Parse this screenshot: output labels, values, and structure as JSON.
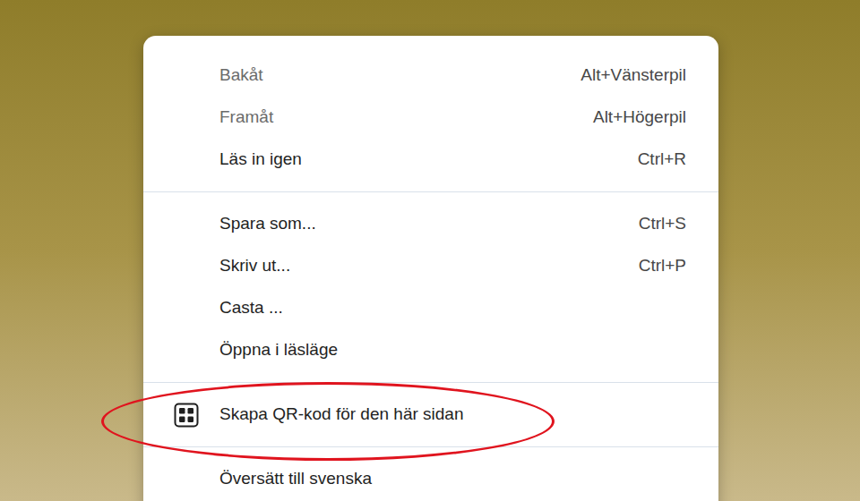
{
  "background": {
    "kind": "photo"
  },
  "context_menu": {
    "sections": [
      {
        "items": [
          {
            "label": "Bakåt",
            "shortcut": "Alt+Vänsterpil",
            "disabled": true,
            "kind": "plain",
            "annotated": false
          },
          {
            "label": "Framåt",
            "shortcut": "Alt+Högerpil",
            "disabled": true,
            "kind": "plain",
            "annotated": false
          },
          {
            "label": "Läs in igen",
            "shortcut": "Ctrl+R",
            "disabled": false,
            "kind": "plain",
            "annotated": false
          }
        ]
      },
      {
        "items": [
          {
            "label": "Spara som...",
            "shortcut": "Ctrl+S",
            "disabled": false,
            "kind": "plain",
            "annotated": false
          },
          {
            "label": "Skriv ut...",
            "shortcut": "Ctrl+P",
            "disabled": false,
            "kind": "plain",
            "annotated": false
          },
          {
            "label": "Casta ...",
            "shortcut": "",
            "disabled": false,
            "kind": "plain",
            "annotated": false
          },
          {
            "label": "Öppna i läsläge",
            "shortcut": "",
            "disabled": false,
            "kind": "plain",
            "annotated": false
          }
        ]
      },
      {
        "items": [
          {
            "label": "Skapa QR-kod för den här sidan",
            "shortcut": "",
            "disabled": false,
            "kind": "icon",
            "annotated": true
          }
        ]
      },
      {
        "items": [
          {
            "label": "Översätt till svenska",
            "shortcut": "",
            "disabled": false,
            "kind": "plain",
            "annotated": false
          }
        ]
      }
    ]
  }
}
